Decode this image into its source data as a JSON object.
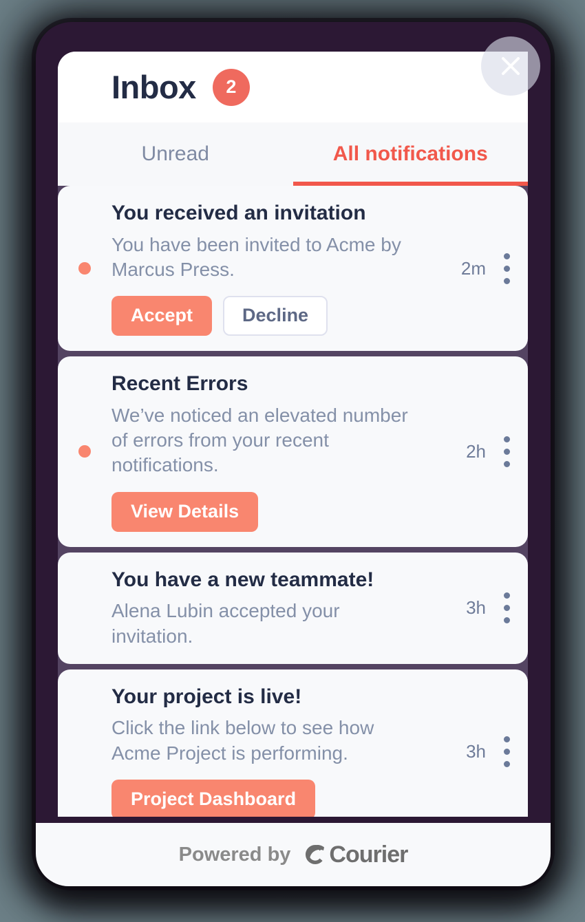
{
  "window": {
    "background_color": "#6d8188",
    "frame_color": "#2c1834",
    "panel_color": "#ffffff",
    "list_background_color": "#544462",
    "accent_color": "#f1584b",
    "button_color": "#f9866f"
  },
  "header": {
    "title": "Inbox",
    "badge_count": "2"
  },
  "close_button": {
    "icon": "close-icon",
    "label": "Close"
  },
  "tabs": [
    {
      "label": "Unread",
      "active": false
    },
    {
      "label": "All notifications",
      "active": true
    }
  ],
  "notifications": [
    {
      "title": "You received an invitation",
      "text": "You have been invited to Acme by Marcus Press.",
      "time": "2m",
      "unread": true,
      "actions": [
        {
          "label": "Accept",
          "style": "primary"
        },
        {
          "label": "Decline",
          "style": "secondary"
        }
      ]
    },
    {
      "title": "Recent Errors",
      "text": "We’ve noticed an elevated number of errors from your recent notifications.",
      "time": "2h",
      "unread": true,
      "actions": [
        {
          "label": "View Details",
          "style": "primary"
        }
      ]
    },
    {
      "title": "You have a new teammate!",
      "text": "Alena Lubin accepted your invitation.",
      "time": "3h",
      "unread": false,
      "actions": []
    },
    {
      "title": "Your project is live!",
      "text": "Click the link below to see how Acme Project is performing.",
      "time": "3h",
      "unread": false,
      "actions": [
        {
          "label": "Project Dashboard",
          "style": "primary"
        }
      ]
    }
  ],
  "footer": {
    "powered_by": "Powered by",
    "brand": "Courier",
    "logo_icon": "courier-logo-icon"
  },
  "menu_icon": "more-vertical-icon"
}
